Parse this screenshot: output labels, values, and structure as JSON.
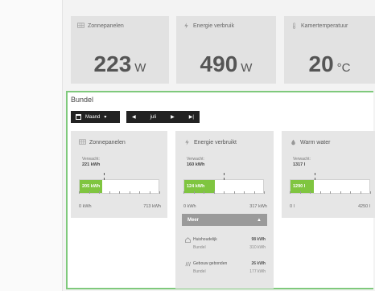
{
  "stats": [
    {
      "label": "Zonnepanelen",
      "value": "223",
      "unit": "W",
      "icon": "solar-panel-icon"
    },
    {
      "label": "Energie verbruik",
      "value": "490",
      "unit": "W",
      "icon": "lightning-icon"
    },
    {
      "label": "Kamertemperatuur",
      "value": "20",
      "unit": "°C",
      "icon": "thermometer-icon"
    }
  ],
  "bundel": {
    "title": "Bundel",
    "period": "Maand",
    "month": "juli"
  },
  "cards": [
    {
      "title": "Zonnepanelen",
      "icon": "solar-panel-icon",
      "expected_label": "Verwacht:",
      "expected_value": "221 kWh",
      "bar_text": "205 kWh",
      "min": "0 kWh",
      "max": "713 kWh",
      "fill_fraction": 0.29,
      "marker_fraction": 0.31
    },
    {
      "title": "Energie verbruikt",
      "icon": "lightning-icon",
      "expected_label": "Verwacht:",
      "expected_value": "160 kWh",
      "bar_text": "124 kWh",
      "min": "0 kWh",
      "max": "317 kWh",
      "fill_fraction": 0.39,
      "marker_fraction": 0.5,
      "more_label": "Meer",
      "subs": [
        {
          "icon": "house-icon",
          "name": "Huishoudelijk",
          "value": "98 kWh",
          "bundel_label": "Bundel",
          "bundel_value": "310 kWh"
        },
        {
          "icon": "building-bound-icon",
          "name": "Gebouw gebonden",
          "value": "26 kWh",
          "bundel_label": "Bundel",
          "bundel_value": "177 kWh"
        }
      ]
    },
    {
      "title": "Warm water",
      "icon": "water-drop-icon",
      "expected_label": "Verwacht:",
      "expected_value": "1317 l",
      "bar_text": "1290 l",
      "min": "0 l",
      "max": "4250 l",
      "fill_fraction": 0.3,
      "marker_fraction": 0.31
    }
  ],
  "colors": {
    "accent_green": "#7fc540",
    "frame_green": "#7fc97c",
    "card_bg": "#e2e2e2",
    "control_bg": "#222222"
  }
}
